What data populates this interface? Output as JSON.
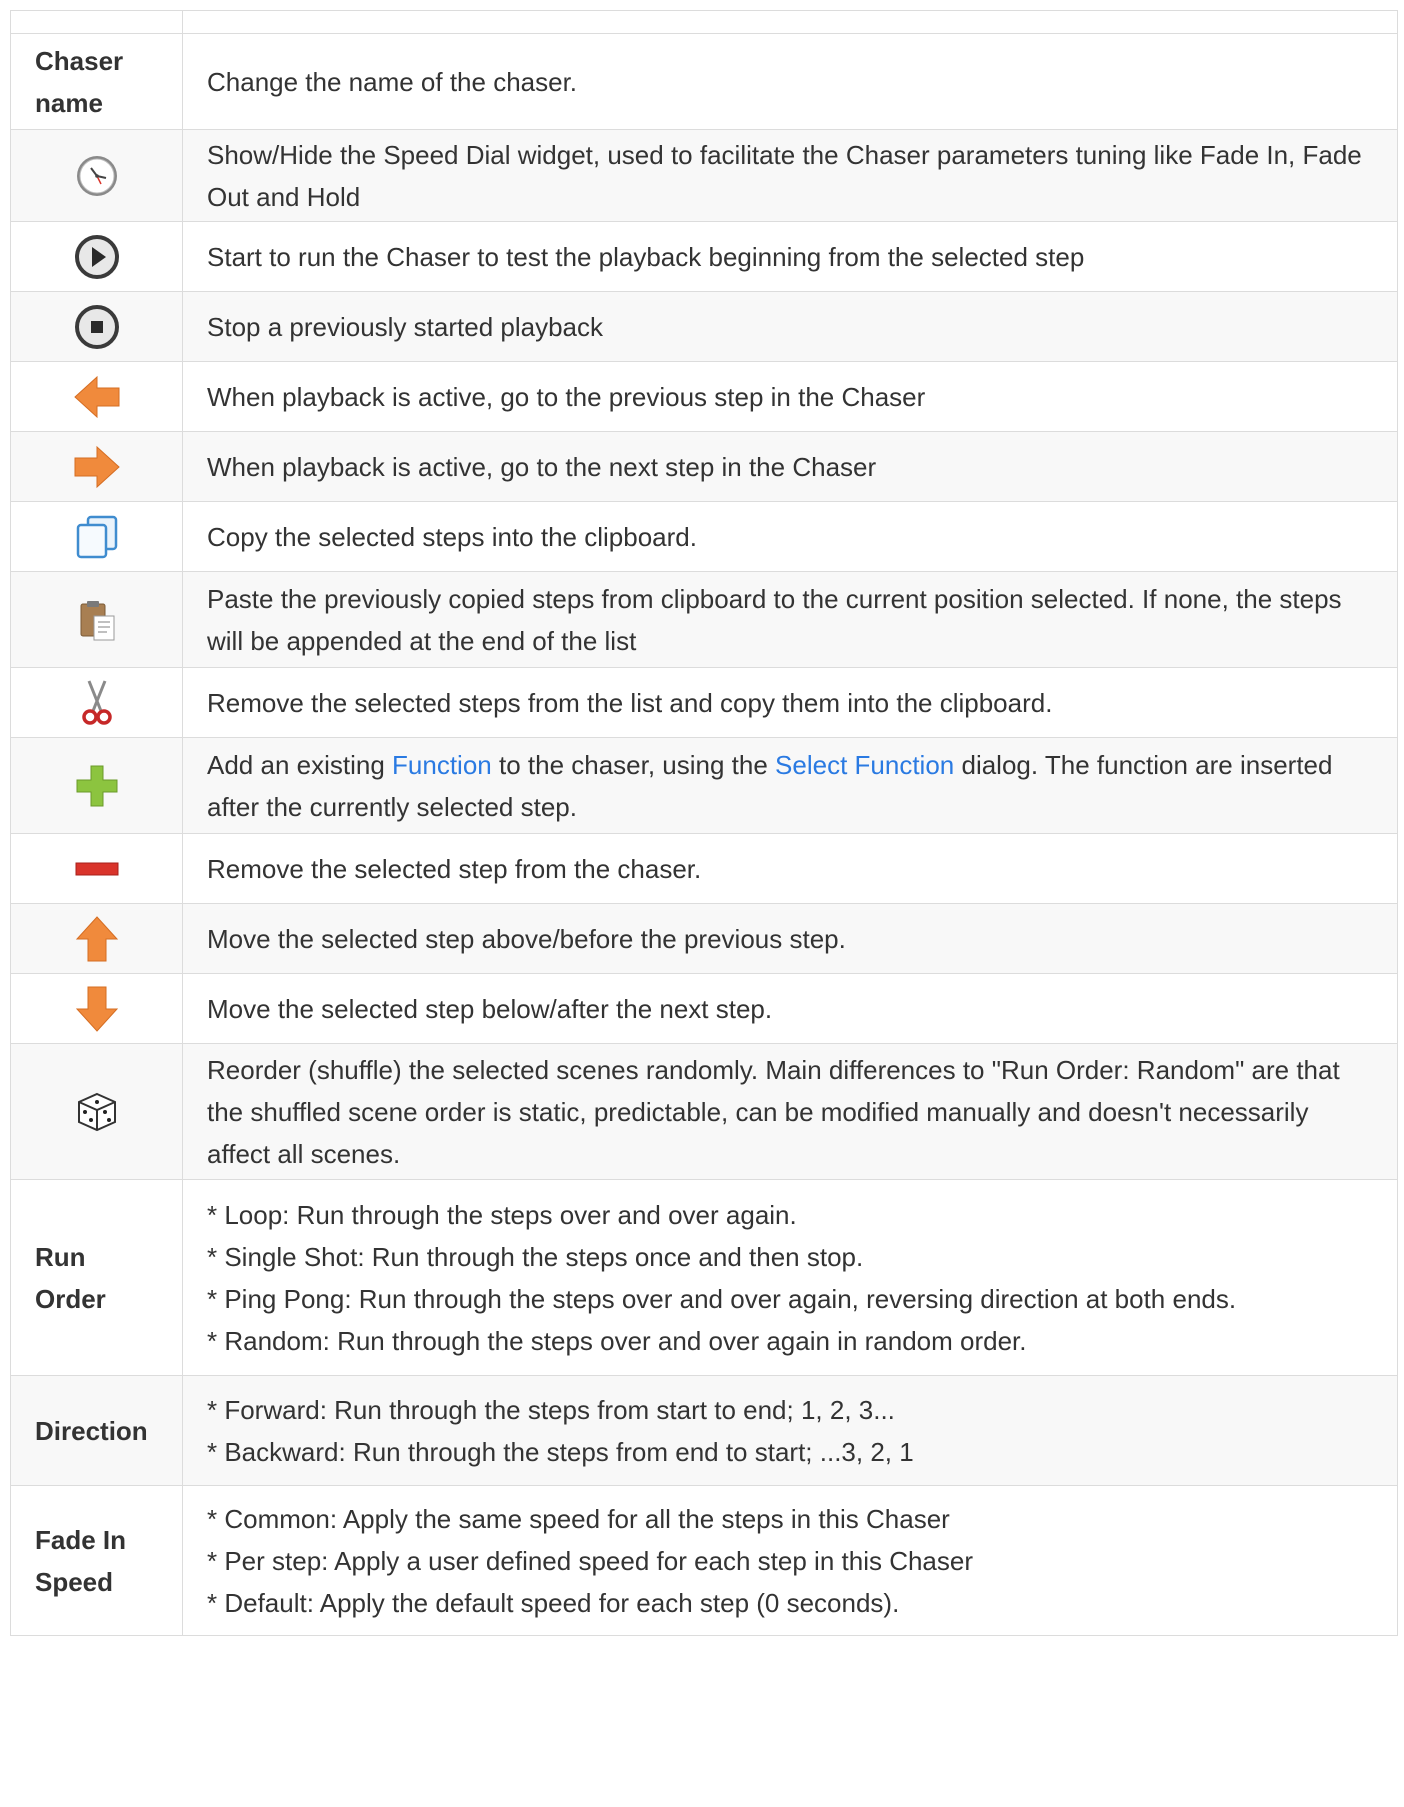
{
  "rows": {
    "chaser_name": {
      "key": "Chaser name",
      "desc": "Change the name of the chaser."
    },
    "speed_dial": {
      "icon": "clock-icon",
      "desc": "Show/Hide the Speed Dial widget, used to facilitate the Chaser parameters tuning like Fade In, Fade Out and Hold"
    },
    "play": {
      "icon": "play-icon",
      "desc": "Start to run the Chaser to test the playback beginning from the selected step"
    },
    "stop": {
      "icon": "stop-icon",
      "desc": "Stop a previously started playback"
    },
    "previous": {
      "icon": "arrow-left-icon",
      "desc": "When playback is active, go to the previous step in the Chaser"
    },
    "next": {
      "icon": "arrow-right-icon",
      "desc": "When playback is active, go to the next step in the Chaser"
    },
    "copy": {
      "icon": "copy-icon",
      "desc": "Copy the selected steps into the clipboard."
    },
    "paste": {
      "icon": "paste-icon",
      "desc": "Paste the previously copied steps from clipboard to the current position selected. If none, the steps will be appended at the end of the list"
    },
    "cut": {
      "icon": "scissors-icon",
      "desc": "Remove the selected steps from the list and copy them into the clipboard."
    },
    "add": {
      "icon": "plus-icon",
      "desc_1": "Add an existing ",
      "link_1": "Function",
      "desc_2": " to the chaser, using the ",
      "link_2": "Select Function",
      "desc_3": " dialog. The function are inserted after the currently selected step."
    },
    "remove": {
      "icon": "minus-icon",
      "desc": "Remove the selected step from the chaser."
    },
    "raise": {
      "icon": "arrow-up-icon",
      "desc": "Move the selected step above/before the previous step."
    },
    "lower": {
      "icon": "arrow-down-icon",
      "desc": "Move the selected step below/after the next step."
    },
    "shuffle": {
      "icon": "dice-icon",
      "desc": "Reorder (shuffle) the selected scenes randomly. Main differences to \"Run Order: Random\" are that the shuffled scene order is static, predictable, can be modified manually and doesn't necessarily affect all scenes."
    },
    "run_order": {
      "key": "Run Order",
      "lines": [
        "* Loop: Run through the steps over and over again.",
        "* Single Shot: Run through the steps once and then stop.",
        "* Ping Pong: Run through the steps over and over again, reversing direction at both ends.",
        "* Random: Run through the steps over and over again in random order."
      ]
    },
    "direction": {
      "key": "Direction",
      "lines": [
        "* Forward: Run through the steps from start to end; 1, 2, 3...",
        "* Backward: Run through the steps from end to start; ...3, 2, 1"
      ]
    },
    "fade_in_speed": {
      "key": "Fade In Speed",
      "lines": [
        "* Common: Apply the same speed for all the steps in this Chaser",
        "* Per step: Apply a user defined speed for each step in this Chaser",
        "* Default: Apply the default speed for each step (0 seconds)."
      ]
    }
  },
  "colors": {
    "link": "#2a7ae2",
    "border": "#dcdcdc",
    "stripe": "#f8f8f8",
    "orange": "#f08a3c",
    "red": "#d9342b",
    "green": "#8cc43f"
  }
}
